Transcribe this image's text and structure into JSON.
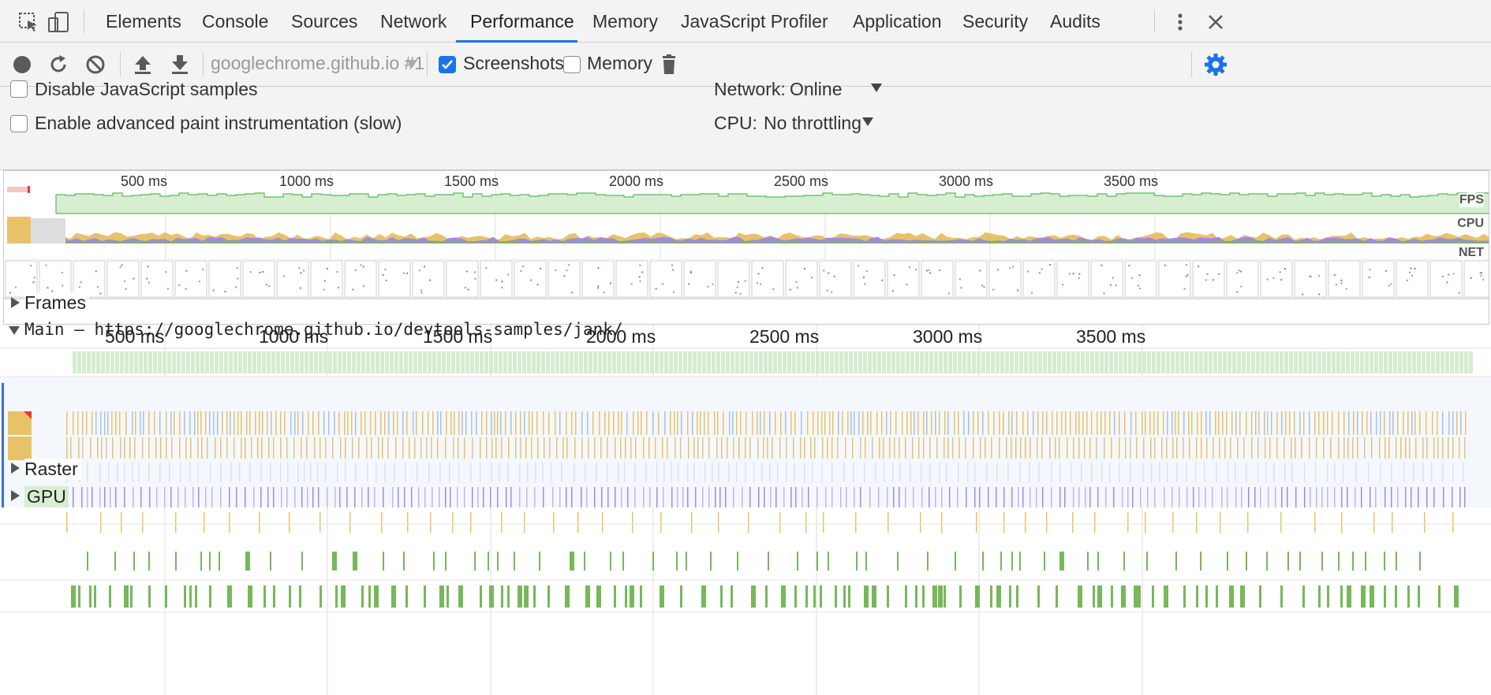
{
  "tabs": [
    "Elements",
    "Console",
    "Sources",
    "Network",
    "Performance",
    "Memory",
    "JavaScript Profiler",
    "Application",
    "Security",
    "Audits"
  ],
  "active_tab": "Performance",
  "toolbar": {
    "profile_select": "googlechrome.github.io #1",
    "screenshots_label": "Screenshots",
    "screenshots_checked": true,
    "memory_label": "Memory",
    "memory_checked": false
  },
  "settings": {
    "disable_js_samples": "Disable JavaScript samples",
    "advanced_paint": "Enable advanced paint instrumentation (slow)",
    "network_label": "Network:",
    "network_value": "Online",
    "cpu_label": "CPU:",
    "cpu_value": "No throttling"
  },
  "overview": {
    "ticks": [
      "500 ms",
      "1000 ms",
      "1500 ms",
      "2000 ms",
      "2500 ms",
      "3000 ms",
      "3500 ms"
    ],
    "fps_label": "FPS",
    "cpu_label": "CPU",
    "net_label": "NET"
  },
  "timeline": {
    "ticks": [
      "500 ms",
      "1000 ms",
      "1500 ms",
      "2000 ms",
      "2500 ms",
      "3000 ms",
      "3500 ms"
    ],
    "frames_label": "Frames",
    "main_label": "Main — https://googlechrome.github.io/devtools-samples/jank/",
    "raster_label": "Raster",
    "gpu_label": "GPU"
  },
  "colors": {
    "accent": "#1a73e8",
    "fps_green": "#5cb85c",
    "scripting": "#e8c268",
    "rendering": "#a18be0",
    "painting": "#76b85a",
    "frame_green": "#d6ecd0"
  }
}
